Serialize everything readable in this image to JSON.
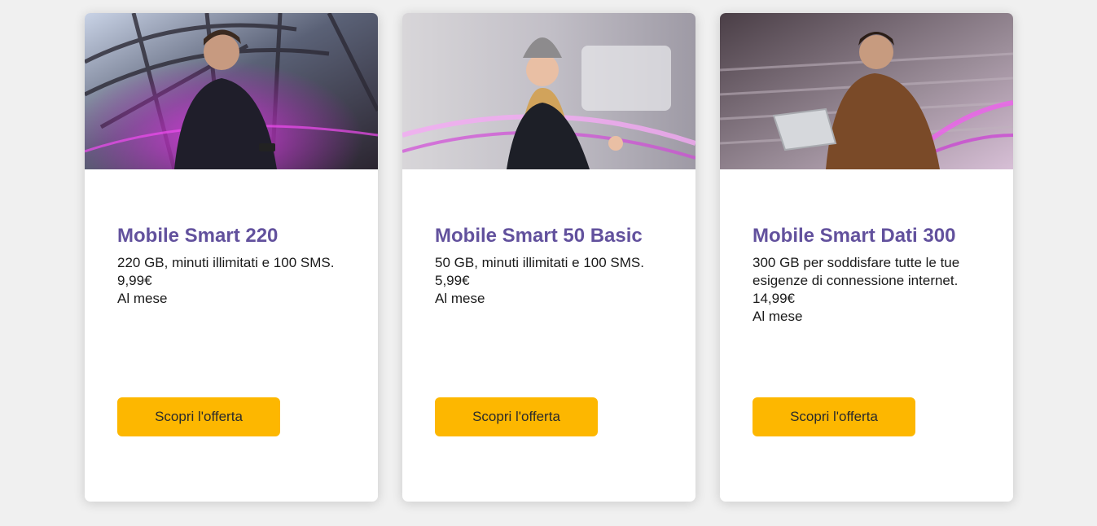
{
  "offers": [
    {
      "title": "Mobile Smart 220",
      "description": "220 GB, minuti illimitati e 100 SMS.",
      "price": "9,99€",
      "period": "Al mese",
      "cta_label": "Scopri l'offerta"
    },
    {
      "title": "Mobile Smart 50 Basic",
      "description": "50 GB, minuti illimitati e 100 SMS.",
      "price": "5,99€",
      "period": "Al mese",
      "cta_label": "Scopri l'offerta"
    },
    {
      "title": "Mobile Smart Dati 300",
      "description": "300 GB per soddisfare tutte le tue esigenze di connessione internet.",
      "price": "14,99€",
      "period": "Al mese",
      "cta_label": "Scopri l'offerta"
    }
  ],
  "colors": {
    "title": "#62519d",
    "button": "#fdb700",
    "accent_glow": "#c81ed2"
  }
}
